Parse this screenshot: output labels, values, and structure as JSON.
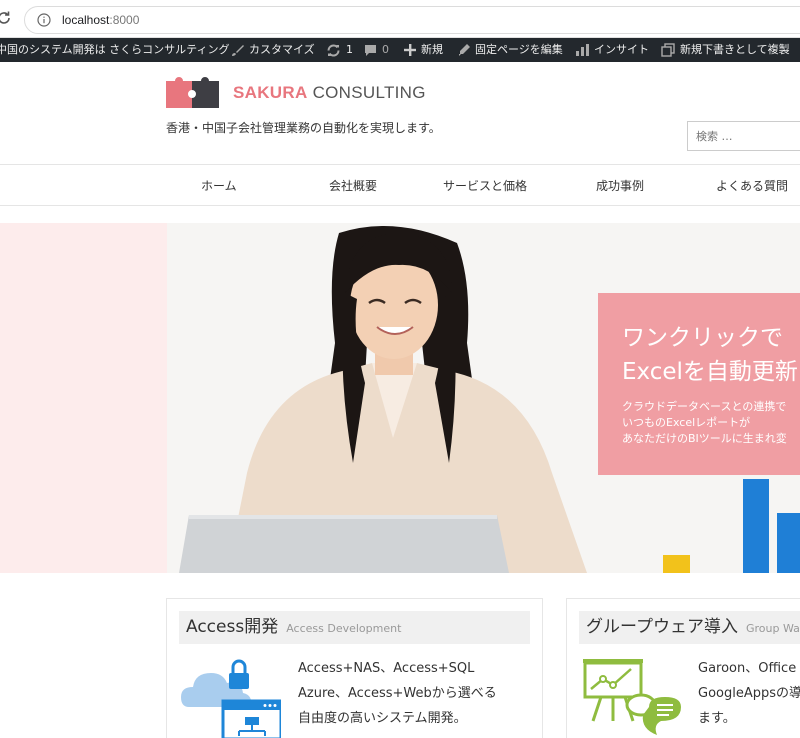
{
  "browser": {
    "url_host": "localhost",
    "url_port": ":8000"
  },
  "admin_bar": {
    "site_name": "中国のシステム開発は さくらコンサルティング",
    "customize": "カスタマイズ",
    "updates_count": "1",
    "comments_count": "0",
    "new": "新規",
    "edit_page": "固定ページを編集",
    "insights": "インサイト",
    "duplicate": "新規下書きとして複製"
  },
  "site": {
    "logo_brand": "SAKURA",
    "logo_rest": "CONSULTING",
    "tagline": "香港・中国子会社管理業務の自動化を実現します。",
    "search_placeholder": "検索 …"
  },
  "nav": [
    "ホーム",
    "会社概要",
    "サービスと価格",
    "成功事例",
    "よくある質問"
  ],
  "hero": {
    "heading_line1": "ワンクリックで",
    "heading_line2": "Excelを自動更新",
    "text_line1": "クラウドデータベースとの連携で",
    "text_line2": "いつものExcelレポートが",
    "text_line3": "あなただけのBIツールに生まれ変"
  },
  "services": [
    {
      "title": "Access開発",
      "subtitle": "Access Development",
      "lines": [
        "Access+NAS、Access+SQL",
        "Azure、Access+Webから選べる",
        "自由度の高いシステム開発。"
      ]
    },
    {
      "title": "グループウェア導入",
      "subtitle": "Group Wa",
      "lines": [
        "Garoon、Office",
        "GoogleAppsの導",
        "ます。"
      ]
    }
  ],
  "colors": {
    "accent_pink": "#e8767e",
    "hero_card": "#f09ea3",
    "hero_left_bg": "#fdecec",
    "admin_bar": "#23282d"
  }
}
